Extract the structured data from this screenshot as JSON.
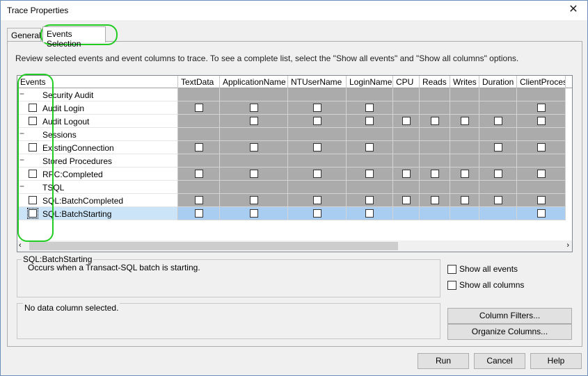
{
  "window": {
    "title": "Trace Properties"
  },
  "tabs": [
    {
      "label": "General"
    },
    {
      "label": "Events Selection"
    }
  ],
  "instructions": "Review selected events and event columns to trace. To see a complete list, select the \"Show all events\" and \"Show all columns\" options.",
  "grid": {
    "events_header": "Events",
    "columns": [
      "TextData",
      "ApplicationName",
      "NTUserName",
      "LoginName",
      "CPU",
      "Reads",
      "Writes",
      "Duration",
      "ClientProcessI"
    ],
    "rows": [
      {
        "type": "category",
        "label": "Security Audit"
      },
      {
        "type": "event",
        "label": "Audit Login"
      },
      {
        "type": "event",
        "label": "Audit Logout"
      },
      {
        "type": "category",
        "label": "Sessions"
      },
      {
        "type": "event",
        "label": "ExistingConnection"
      },
      {
        "type": "category",
        "label": "Stored Procedures"
      },
      {
        "type": "event",
        "label": "RPC:Completed"
      },
      {
        "type": "category",
        "label": "TSQL"
      },
      {
        "type": "event",
        "label": "SQL:BatchCompleted"
      },
      {
        "type": "event",
        "label": "SQL:BatchStarting",
        "selected": true
      }
    ]
  },
  "description_box": {
    "title": "SQL:BatchStarting",
    "text": "Occurs when a Transact-SQL batch is starting."
  },
  "options": {
    "show_all_events": "Show all events",
    "show_all_columns": "Show all columns"
  },
  "column_box": {
    "text": "No data column selected."
  },
  "buttons": {
    "column_filters": "Column Filters...",
    "organize_columns": "Organize Columns...",
    "run": "Run",
    "cancel": "Cancel",
    "help": "Help"
  },
  "colors": {
    "annotation": "#22cc22",
    "selection": "#cce4f7",
    "unavailable_cell": "#ababab"
  }
}
